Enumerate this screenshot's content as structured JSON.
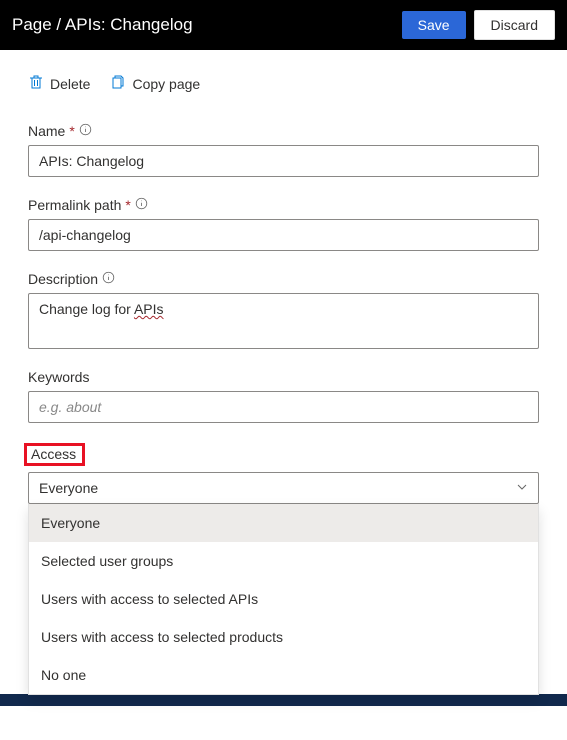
{
  "header": {
    "breadcrumb": "Page / APIs: Changelog",
    "save": "Save",
    "discard": "Discard"
  },
  "toolbar": {
    "delete": "Delete",
    "copy": "Copy page"
  },
  "fields": {
    "name": {
      "label": "Name",
      "value": "APIs: Changelog"
    },
    "permalink": {
      "label": "Permalink path",
      "value": "/api-changelog"
    },
    "description": {
      "label": "Description",
      "prefix": "Change log for ",
      "spell": "APIs"
    },
    "keywords": {
      "label": "Keywords",
      "placeholder": "e.g. about"
    },
    "access": {
      "label": "Access",
      "selected": "Everyone"
    }
  },
  "access_options": [
    "Everyone",
    "Selected user groups",
    "Users with access to selected APIs",
    "Users with access to selected products",
    "No one"
  ]
}
